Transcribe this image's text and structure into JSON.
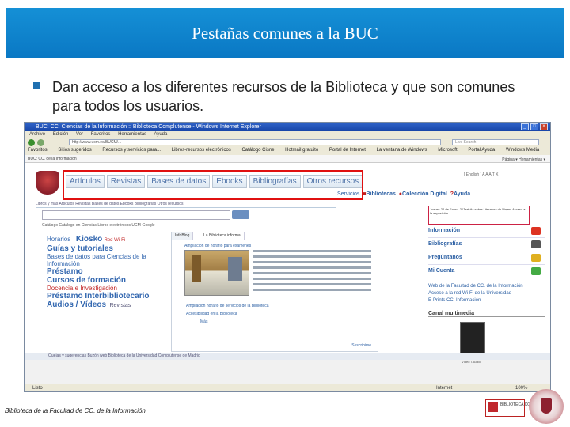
{
  "slide": {
    "title": "Pestañas comunes a la BUC",
    "bullet": "Dan acceso a los diferentes recursos de la Biblioteca y que son comunes para todos los usuarios.",
    "footer": "Biblioteca de la Facultad de CC. de la Información"
  },
  "colors": {
    "title_bg": "#1590d6",
    "highlight_box": "#e01010",
    "link": "#2b5fa3",
    "menu_red": "#c02020"
  },
  "browser": {
    "window_title": "BUC, CC. Ciencias de la Información :: Biblioteca Complutense - Windows Internet Explorer",
    "menu": [
      "Archivo",
      "Edición",
      "Ver",
      "Favoritos",
      "Herramientas",
      "Ayuda"
    ],
    "address": "http://www.ucm.es/BUCM/...",
    "search_placeholder": "Live Search",
    "favorites": [
      "Favoritos",
      "Sitios sugeridos",
      "Recursos y servicios para...",
      "Libros-recursos electrónicos",
      "Catálogo Cisne",
      "Hotmail gratuito",
      "Portal de Internet",
      "La ventana de Windows",
      "Microsoft",
      "Portal Ayuda",
      "Windows Media"
    ],
    "tab": "BUC: CC. de la Información",
    "tab_tools": "Página ▾  Herramientas ▾",
    "page": {
      "tabs": [
        "Artículos",
        "Revistas",
        "Bases de datos",
        "Ebooks",
        "Bibliografías",
        "Otros recursos"
      ],
      "language": "[ English ]  A A A  T X",
      "services": [
        "Servicios",
        "Bibliotecas",
        "Colección Digital",
        "Ayuda"
      ],
      "sub_tabs": "Libros y más   Artículos   Revistas   Bases de datos   Ebooks   Bibliografías   Otros recursos",
      "radios": "Catálogo   Catálogo en Ciencias   Libros electrónicos UCM-Google",
      "left_menu": [
        {
          "label": "Horarios",
          "extra": "Kiosko",
          "extra2": "Red Wi-Fi"
        },
        {
          "label": "Guías y tutoriales"
        },
        {
          "label": "Bases de datos para Ciencias de la Información"
        },
        {
          "label": "Préstamo"
        },
        {
          "label": "Cursos de formación"
        },
        {
          "label": "Docencia e Investigación"
        },
        {
          "label": "Préstamo Interbibliotecario"
        },
        {
          "label": "Audios / Vídeos",
          "extra": "Revistas"
        }
      ],
      "info": {
        "tab1": "InfoBlog",
        "tab2": "La Biblioteca informa",
        "headline": "Ampliación de horario para exámenes",
        "links": [
          "Ampliación horario de servicios de la Biblioteca",
          "Accesibilidad en la Biblioteca",
          "Más"
        ],
        "subscribe": "Suscribirse"
      },
      "right": {
        "news": "Jueves 22 de Enero. 2ª Tertulia sobre Literatura de Viajes. Acceso a la exposición",
        "items": [
          "Información",
          "Bibliografías",
          "Pregúntanos",
          "Mi Cuenta"
        ],
        "links": [
          "Web de la Facultad de CC. de la Información",
          "Acceso a la red Wi-Fi de la Universidad",
          "E-Prints CC. Información"
        ],
        "canal": "Canal multimedia",
        "video_label": "Vídeo  I  Audio"
      },
      "footer_links": "Quejas y sugerencias   Buzón web   Biblioteca de la Universidad Complutense de Madrid"
    },
    "status": "Listo",
    "zone": "Internet",
    "zoom": "100%"
  },
  "logos": {
    "ucm_text": "BIBLIOTECA COMPLUTENSE",
    "seal_text": "UNIVERSIDAD COMPLUTENSE"
  }
}
